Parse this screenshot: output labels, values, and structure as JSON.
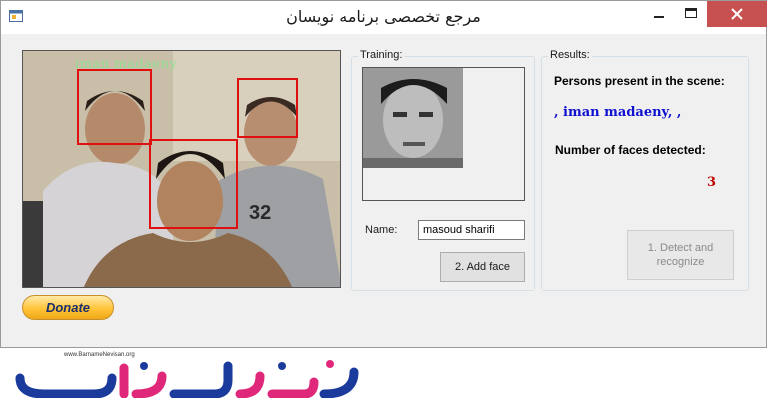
{
  "window": {
    "title": "مرجع تخصصی برنامه نویسان"
  },
  "camera": {
    "overlay_name": "iman madaeny"
  },
  "training": {
    "group_label": "Training:",
    "name_label": "Name:",
    "name_value": "masoud sharifi",
    "add_face_label": "2. Add face"
  },
  "results": {
    "group_label": "Results:",
    "persons_heading": "Persons present in the scene:",
    "persons_value": ", iman madaeny, ,",
    "faces_heading": "Number of faces detected:",
    "faces_value": "3",
    "detect_button_label": "1. Detect and recognize"
  },
  "donate": {
    "label": "Donate"
  },
  "logo": {
    "url": "www.BarnameNevisan.org",
    "text": "برنامه نویسان"
  },
  "colors": {
    "accent_blue": "#1010d0",
    "count_red": "#c00000",
    "face_box": "#e01010",
    "logo_blue": "#1a3a9c",
    "logo_pink": "#e0287a"
  }
}
